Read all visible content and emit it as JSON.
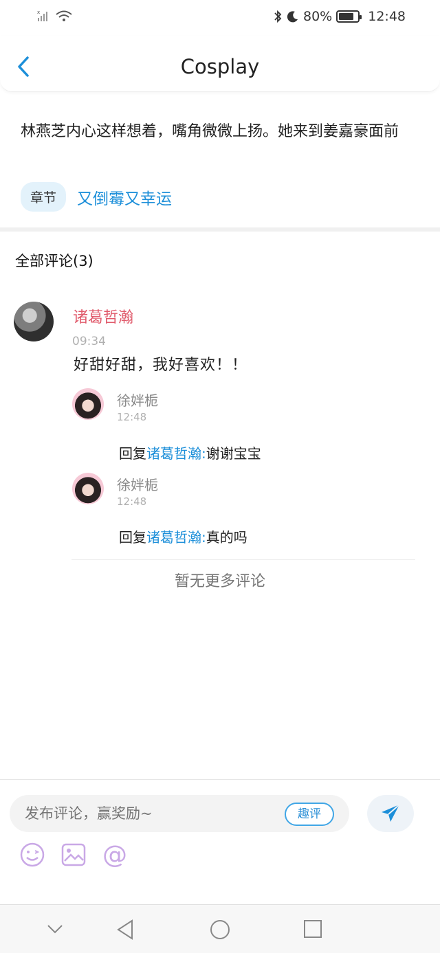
{
  "status_bar": {
    "battery": "80%",
    "time": "12:48",
    "battery_level": 0.8
  },
  "header": {
    "title": "Cosplay"
  },
  "quote": {
    "text": "林燕芝内心这样想着，嘴角微微上扬。她来到姜嘉豪面前",
    "chapter_tag": "章节",
    "chapter_title": "又倒霉又幸运"
  },
  "comments": {
    "title": "全部评论(3)",
    "main": {
      "author": "诸葛哲瀚",
      "time": "09:34",
      "text": "好甜好甜，我好喜欢！！"
    },
    "replies": [
      {
        "author": "徐姅栀",
        "time": "12:48",
        "prefix": "回复",
        "target": "诸葛哲瀚:",
        "text": "谢谢宝宝"
      },
      {
        "author": "徐姅栀",
        "time": "12:48",
        "prefix": "回复",
        "target": "诸葛哲瀚:",
        "text": "真的吗"
      }
    ],
    "no_more": "暂无更多评论"
  },
  "input_bar": {
    "placeholder": "发布评论，赢奖励~",
    "quping_label": "趣评"
  },
  "colors": {
    "accent_blue": "#1d8fd9",
    "name_red": "#e05a6b",
    "icon_purple": "#c9a8e6"
  }
}
